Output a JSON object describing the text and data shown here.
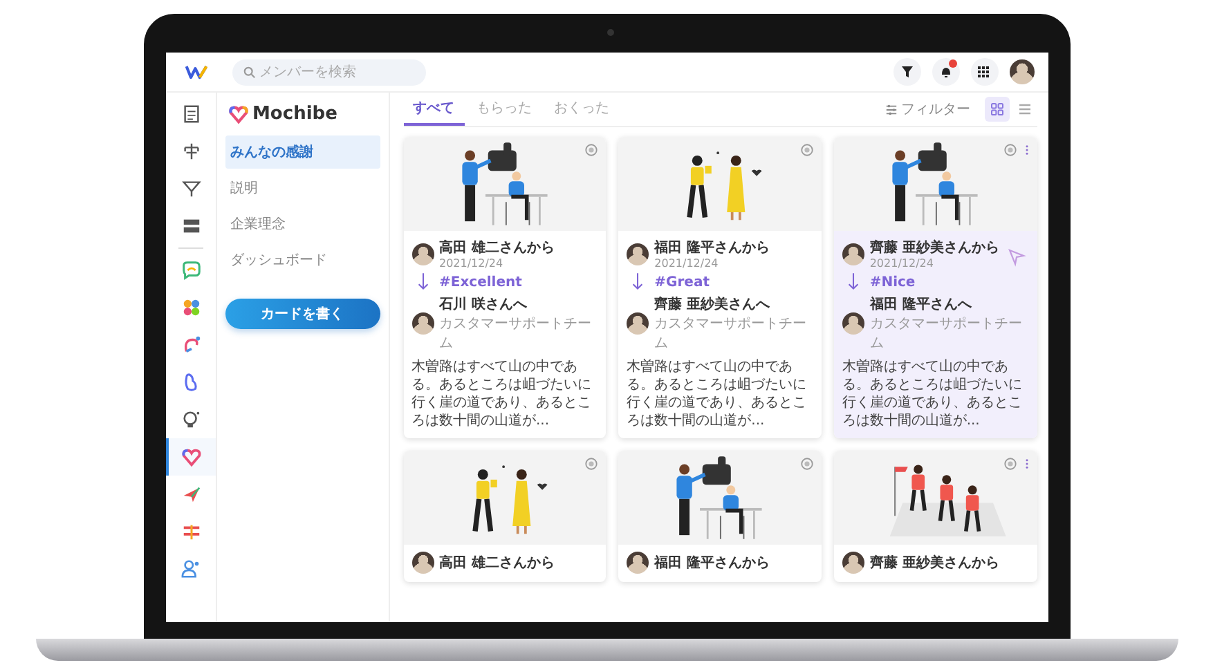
{
  "topbar": {
    "search": {
      "placeholder": "メンバーを検索"
    },
    "notification_badge": true
  },
  "rail": [
    {
      "kind": "doc",
      "selected": false
    },
    {
      "kind": "tree",
      "selected": false
    },
    {
      "kind": "funnel",
      "selected": false
    },
    {
      "kind": "server",
      "selected": false
    },
    {
      "kind": "chat",
      "selected": false
    },
    {
      "kind": "petals",
      "selected": false
    },
    {
      "kind": "loop",
      "selected": false
    },
    {
      "kind": "drop",
      "selected": false
    },
    {
      "kind": "bulb",
      "selected": false
    },
    {
      "kind": "heart",
      "selected": true
    },
    {
      "kind": "plane",
      "selected": false
    },
    {
      "kind": "flag",
      "selected": false
    },
    {
      "kind": "people",
      "selected": false
    }
  ],
  "sidebar": {
    "app_name": "Mochibe",
    "items": [
      {
        "label": "みんなの感謝",
        "selected": true
      },
      {
        "label": "説明",
        "selected": false
      },
      {
        "label": "企業理念",
        "selected": false
      },
      {
        "label": "ダッシュボード",
        "selected": false
      }
    ],
    "button": "カードを書く"
  },
  "tabs": [
    {
      "label": "すべて",
      "selected": true
    },
    {
      "label": "もらった",
      "selected": false
    },
    {
      "label": "おくった",
      "selected": false
    }
  ],
  "filter": "フィルター",
  "view_toggle": [
    {
      "kind": "grid",
      "selected": true
    },
    {
      "kind": "list",
      "selected": false
    }
  ],
  "cards": [
    {
      "kind": "office",
      "menu": false,
      "selected": false,
      "from": "高田 雄二さんから",
      "date": "2021/12/24",
      "tag": "#Excellent",
      "to": "石川 咲さんへ",
      "team": "カスタマーサポートチーム",
      "text": "木曽路はすべて山の中である。あるところは岨づたいに行く崖の道であり、あるところは数十間の山道が..."
    },
    {
      "kind": "celebration",
      "menu": false,
      "selected": false,
      "from": "福田 隆平さんから",
      "date": "2021/12/24",
      "tag": "#Great",
      "to": "齊藤 亜紗美さんへ",
      "team": "カスタマーサポートチーム",
      "text": "木曽路はすべて山の中である。あるところは岨づたいに行く崖の道であり、あるところは数十間の山道が..."
    },
    {
      "kind": "office",
      "menu": true,
      "selected": true,
      "from": "齊藤 亜紗美さんから",
      "date": "2021/12/24",
      "tag": "#Nice",
      "to": "福田 隆平さんへ",
      "team": "カスタマーサポートチーム",
      "text": "木曽路はすべて山の中である。あるところは岨づたいに行く崖の道であり、あるところは数十間の山道が..."
    },
    {
      "kind": "celebration",
      "menu": false,
      "selected": false,
      "from": "高田 雄二さんから"
    },
    {
      "kind": "office",
      "menu": false,
      "selected": false,
      "from": "福田 隆平さんから"
    },
    {
      "kind": "climbing",
      "menu": true,
      "selected": false,
      "from": "齊藤 亜紗美さんから"
    }
  ]
}
